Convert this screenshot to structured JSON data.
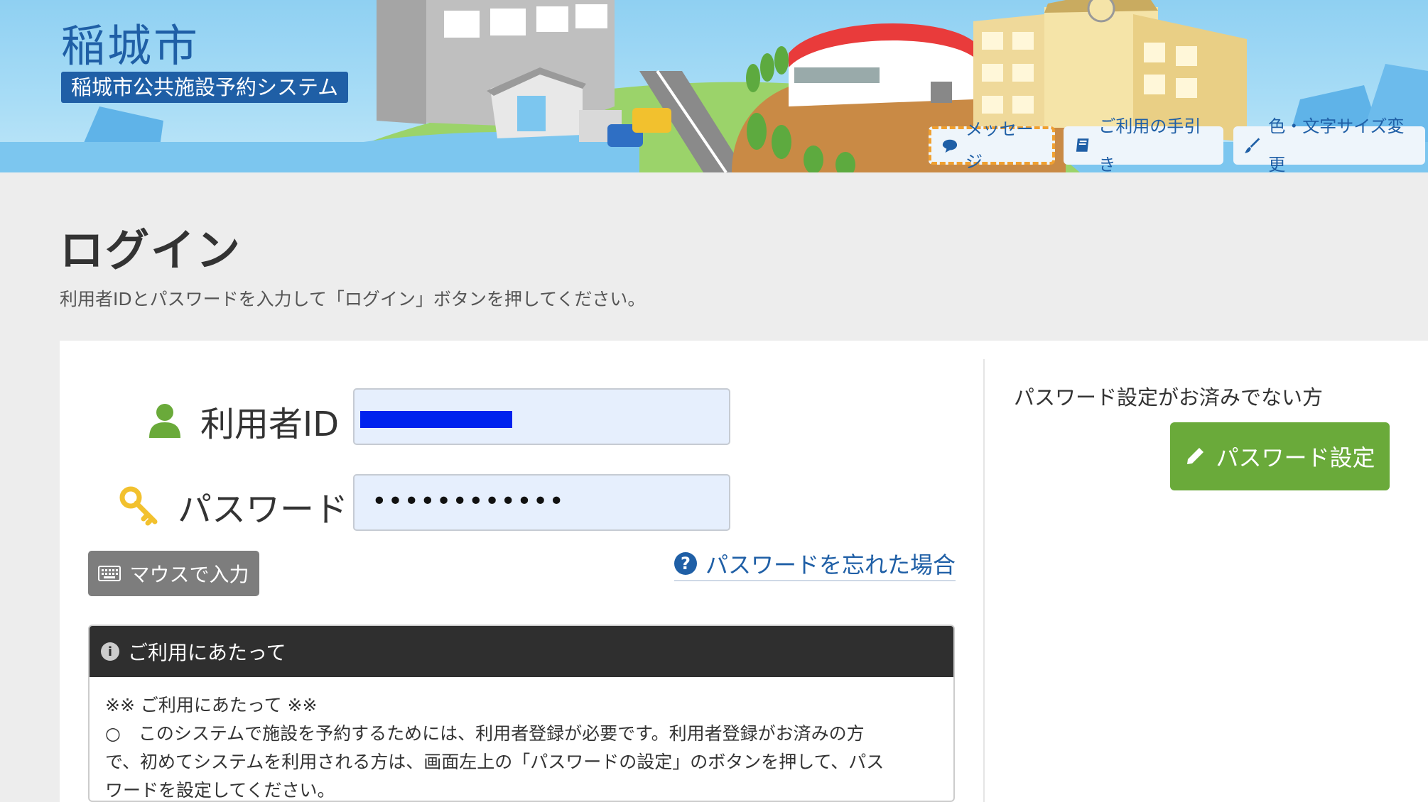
{
  "header": {
    "city_name": "稲城市",
    "system_name": "稲城市公共施設予約システム",
    "buttons": {
      "message": "メッセージ",
      "guide": "ご利用の手引き",
      "color_size": "色・文字サイズ変更"
    }
  },
  "page": {
    "title": "ログイン",
    "description": "利用者IDとパスワードを入力して「ログイン」ボタンを押してください。"
  },
  "login_form": {
    "user_id_label": "利用者ID",
    "password_label": "パスワード",
    "password_value": "••••••••••••",
    "mouse_input_button": "マウスで入力",
    "forgot_password_link": "パスワードを忘れた場合"
  },
  "notice": {
    "title": "ご利用にあたって",
    "heading": "※※ ご利用にあたって ※※",
    "line1": "○　このシステムで施設を予約するためには、利用者登録が必要です。利用者登録がお済みの方",
    "line2": "で、初めてシステムを利用される方は、画面左上の「パスワードの設定」のボタンを押して、パス",
    "line3": "ワードを設定してください。"
  },
  "password_setup": {
    "label": "パスワード設定がお済みでない方",
    "button": "パスワード設定"
  },
  "colors": {
    "brand_blue": "#1f5fa6",
    "green_button": "#6aaa3a",
    "gray_button": "#7d7d7d"
  }
}
